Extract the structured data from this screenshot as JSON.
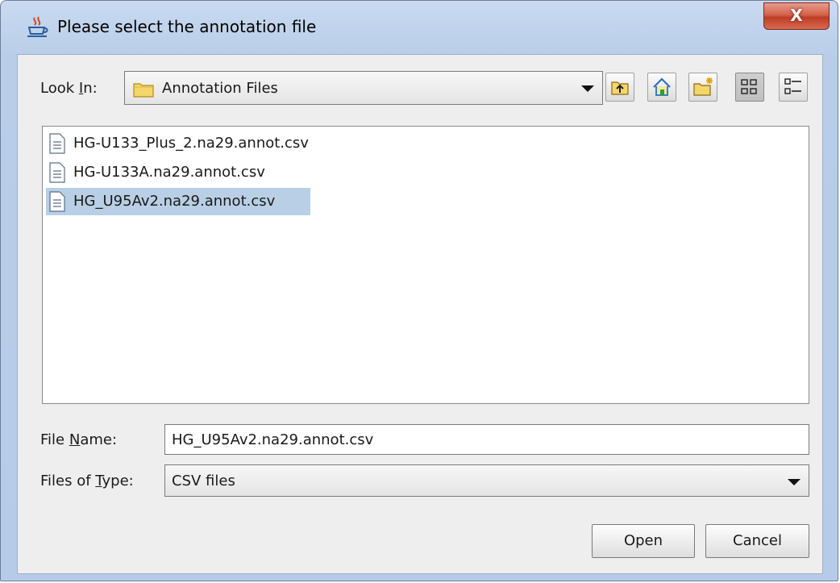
{
  "window": {
    "title": "Please select the annotation file",
    "close_glyph": "X"
  },
  "look_in": {
    "label_pre": "Look ",
    "label_mnemonic": "I",
    "label_post": "n:",
    "value": "Annotation Files"
  },
  "toolbar": {
    "icons": [
      "up-one-level-icon",
      "home-icon",
      "new-folder-icon",
      "list-view-icon",
      "details-view-icon"
    ]
  },
  "files": [
    {
      "name": "HG-U133_Plus_2.na29.annot.csv",
      "selected": false
    },
    {
      "name": "HG-U133A.na29.annot.csv",
      "selected": false
    },
    {
      "name": "HG_U95Av2.na29.annot.csv",
      "selected": true
    }
  ],
  "file_name": {
    "label_pre": "File ",
    "label_mnemonic": "N",
    "label_post": "ame:",
    "value": "HG_U95Av2.na29.annot.csv"
  },
  "file_type": {
    "label_pre": "Files of ",
    "label_mnemonic": "T",
    "label_post": "ype:",
    "value": "CSV files"
  },
  "buttons": {
    "open": "Open",
    "cancel": "Cancel"
  },
  "colors": {
    "selection": "#b8cfe5",
    "frame": "#b9cde9",
    "close_button": "#c03d27"
  }
}
